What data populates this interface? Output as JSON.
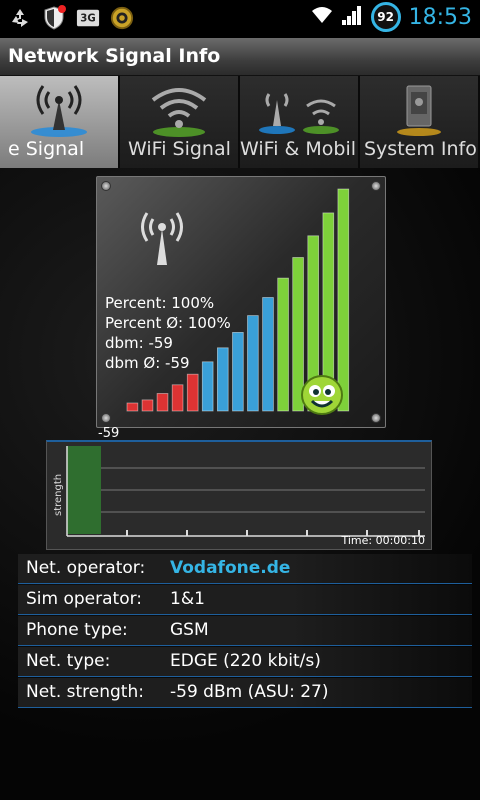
{
  "status_bar": {
    "battery": "92",
    "time": "18:53",
    "network_badge": "3G",
    "icons": [
      "recycle-icon",
      "shield-icon",
      "3g-icon",
      "target-icon",
      "wifi-icon",
      "signal-icon"
    ]
  },
  "app": {
    "title": "Network Signal Info"
  },
  "tabs": [
    {
      "label": "e Signal",
      "active": true,
      "icon": "mobile-antenna-icon"
    },
    {
      "label": "WiFi Signal",
      "active": false,
      "icon": "wifi-icon"
    },
    {
      "label": "WiFi & Mobil",
      "active": false,
      "icon": "wifi-mobile-icon"
    },
    {
      "label": "System Info",
      "active": false,
      "icon": "system-info-icon"
    }
  ],
  "signal": {
    "percent": "Percent: 100%",
    "percent_avg": "Percent Ø: 100%",
    "dbm": "dbm: -59",
    "dbm_avg": "dbm Ø: -59",
    "bars_total": 15,
    "bars_lit": 15
  },
  "graph": {
    "value_label": "-59",
    "axis_label": "strength",
    "time": "Time: 00:00:10"
  },
  "info": [
    {
      "key": "Net. operator:",
      "value": "Vodafone.de",
      "link": true
    },
    {
      "key": "Sim operator:",
      "value": "1&1",
      "link": false
    },
    {
      "key": "Phone type:",
      "value": "GSM",
      "link": false
    },
    {
      "key": "Net. type:",
      "value": "EDGE (220 kbit/s)",
      "link": false
    },
    {
      "key": "Net. strength:",
      "value": "-59 dBm (ASU: 27)",
      "link": false
    }
  ],
  "colors": {
    "accent": "#35b5e5",
    "bar_low": "#d33",
    "bar_mid": "#3aa0d8",
    "bar_high": "#7ed13a"
  }
}
